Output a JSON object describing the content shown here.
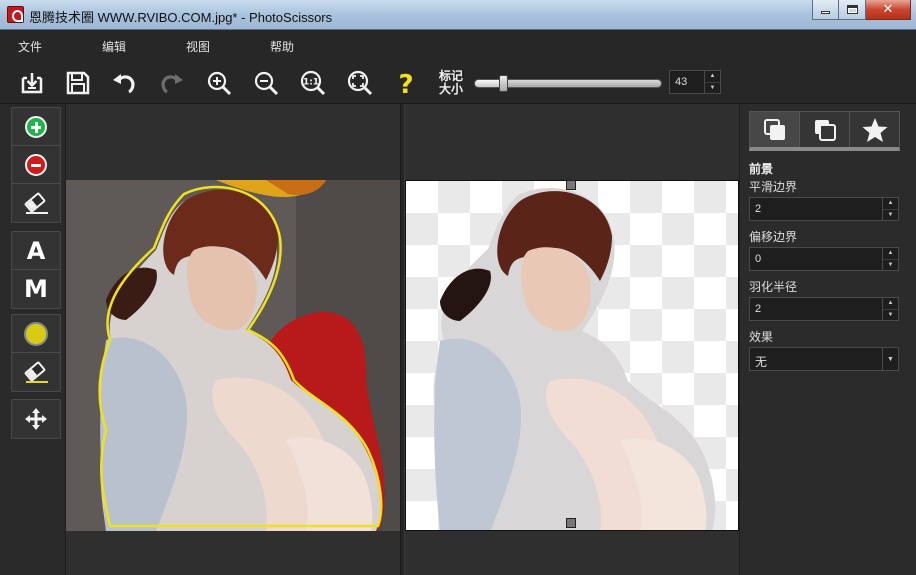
{
  "window": {
    "title": "恩腾技术圈 WWW.RVIBO.COM.jpg* - PhotoScissors"
  },
  "menu": [
    "文件",
    "编辑",
    "视图",
    "帮助"
  ],
  "toolbar": {
    "buttons": [
      "open-icon",
      "save-icon",
      "undo-icon",
      "redo-icon",
      "zoom-in-icon",
      "zoom-out-icon",
      "actual-size-icon",
      "fit-icon",
      "help-icon"
    ],
    "marker_size_label": "标记大小",
    "marker_size_value": "43",
    "marker_size_fraction": 0.15
  },
  "left_tools": {
    "letter_a": "A",
    "letter_m": "M"
  },
  "right_panel": {
    "section_title": "前景",
    "smooth_label": "平滑边界",
    "smooth_value": "2",
    "offset_label": "偏移边界",
    "offset_value": "0",
    "feather_label": "羽化半径",
    "feather_value": "2",
    "effect_label": "效果",
    "effect_value": "无"
  },
  "colors": {
    "accent_yellow": "#e6d916",
    "keep_green": "#22b24c",
    "remove_red": "#d11b1b",
    "remove_mark": "#b8191a"
  }
}
